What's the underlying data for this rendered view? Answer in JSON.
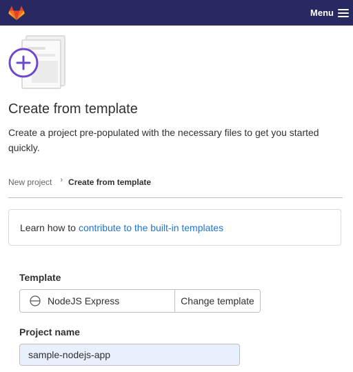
{
  "topbar": {
    "logo_icon": "gitlab-tanuki-icon",
    "menu_label": "Menu",
    "menu_icon": "hamburger-icon",
    "bg_color": "#292961"
  },
  "header": {
    "illustration_icon": "create-from-template-illustration",
    "title": "Create from template",
    "description": "Create a project pre-populated with the necessary files to get you started quickly."
  },
  "breadcrumb": {
    "items": [
      "New project",
      "Create from template"
    ],
    "separator_icon": "chevron-right-icon"
  },
  "info_box": {
    "text": "Learn how to",
    "link_text": "contribute to the built-in templates",
    "link_color": "#1f75cb"
  },
  "form": {
    "template_label": "Template",
    "template_icon": "nodejs-template-icon",
    "template_value": "NodeJS Express",
    "change_template_label": "Change template",
    "project_name_label": "Project name",
    "project_name_value": "sample-nodejs-app"
  }
}
